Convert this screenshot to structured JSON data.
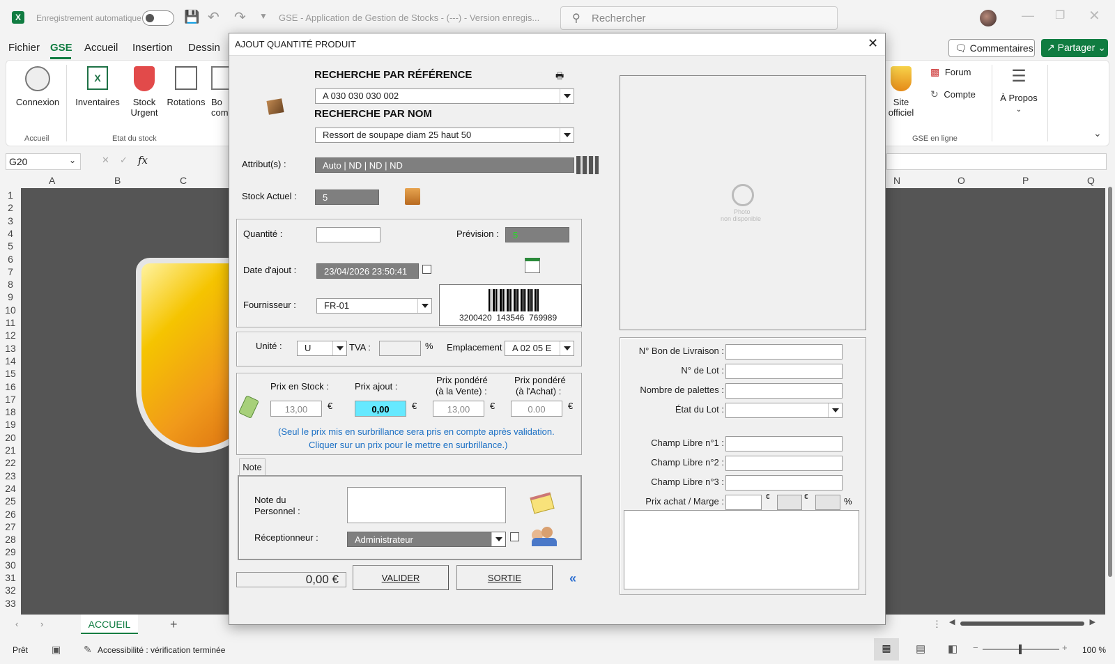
{
  "window": {
    "autosave_label": "Enregistrement automatique",
    "title": "GSE - Application de Gestion de Stocks - (---) - Version enregis...",
    "search_placeholder": "Rechercher"
  },
  "menu": {
    "tabs": [
      "Fichier",
      "GSE",
      "Accueil",
      "Insertion",
      "Dessin"
    ],
    "comments_label": "Commentaires",
    "share_label": "Partager"
  },
  "ribbon": {
    "connexion": "Connexion",
    "group_accueil": "Accueil",
    "inventaires": "Inventaires",
    "stock_urgent_1": "Stock",
    "stock_urgent_2": "Urgent",
    "rotations": "Rotations",
    "bon_partial_1": "Bo",
    "bon_partial_2": "comr",
    "group_etat": "Etat du stock",
    "site_1": "Site",
    "site_2": "officiel",
    "forum": "Forum",
    "compte": "Compte",
    "apropos": "À Propos",
    "group_online": "GSE en ligne"
  },
  "formula": {
    "cell_ref": "G20",
    "fx": "fx"
  },
  "columns": {
    "left": [
      "A",
      "B",
      "C"
    ],
    "right": [
      "N",
      "O",
      "P",
      "Q"
    ]
  },
  "rows": [
    "1",
    "2",
    "3",
    "4",
    "5",
    "6",
    "7",
    "8",
    "9",
    "10",
    "11",
    "12",
    "13",
    "14",
    "15",
    "16",
    "17",
    "18",
    "19",
    "20",
    "21",
    "22",
    "23",
    "24",
    "25",
    "26",
    "27",
    "28",
    "29",
    "30",
    "31",
    "32",
    "33"
  ],
  "sheet_tabs": {
    "active": "ACCUEIL"
  },
  "status": {
    "ready": "Prêt",
    "accessibility": "Accessibilité : vérification terminée",
    "zoom": "100 %"
  },
  "dialog": {
    "title": "AJOUT QUANTITÉ PRODUIT",
    "search_ref_label": "RECHERCHE PAR RÉFÉRENCE",
    "search_ref_value": "A 030 030 030 002",
    "search_name_label": "RECHERCHE PAR NOM",
    "search_name_value": "Ressort de soupape diam 25 haut 50",
    "attributes_label": "Attribut(s) :",
    "attributes_value": "Auto | ND | ND | ND",
    "stock_label": "Stock Actuel :",
    "stock_value": "5",
    "quantity_label": "Quantité :",
    "quantity_value": "",
    "prevision_label": "Prévision :",
    "prevision_value": "5",
    "date_label": "Date d'ajout :",
    "date_value": "23/04/2026 23:50:41",
    "supplier_label": "Fournisseur :",
    "supplier_value": "FR-01",
    "barcode_text": "3200420  143546  769989",
    "unit_label": "Unité :",
    "unit_value": "U",
    "tva_label": "TVA :",
    "tva_value": "",
    "percent": "%",
    "location_label": "Emplacement :",
    "location_value": "A 02 05  E",
    "price_stock_label": "Prix en Stock :",
    "price_stock_value": "13,00",
    "price_add_label": "Prix ajout :",
    "price_add_value": "0,00",
    "price_sale_label_1": "Prix pondéré",
    "price_sale_label_2": "(à la Vente) :",
    "price_sale_value": "13,00",
    "price_buy_label_1": "Prix pondéré",
    "price_buy_label_2": "(à l'Achat) :",
    "price_buy_value": "0.00",
    "euro": "€",
    "hint_1": "(Seul le prix mis en surbrillance sera pris en compte après validation.",
    "hint_2": "Cliquer sur un prix pour le mettre en surbrillance.)",
    "note_tab": "Note",
    "note_label_1": "Note du",
    "note_label_2": "Personnel :",
    "receiver_label": "Réceptionneur :",
    "receiver_value": "Administrateur",
    "total_value": "0,00 €",
    "validate_label": "VALIDER",
    "exit_label": "SORTIE",
    "photo_text_1": "Photo",
    "photo_text_2": "non disponible",
    "delivery_label": "N° Bon de Livraison :",
    "lot_label": "N° de Lot :",
    "pallets_label": "Nombre de palettes :",
    "lot_state_label": "État du Lot :",
    "free1_label": "Champ Libre n°1 :",
    "free2_label": "Champ Libre n°2 :",
    "free3_label": "Champ Libre n°3 :",
    "margin_label": "Prix achat / Marge :"
  }
}
